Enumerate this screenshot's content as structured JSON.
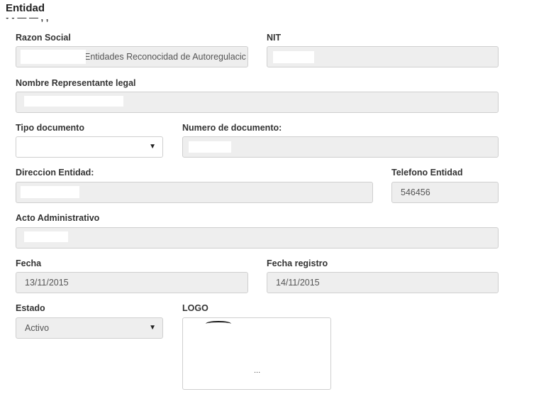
{
  "page": {
    "title": "Entidad"
  },
  "form": {
    "razon_social": {
      "label": "Razon Social",
      "value": "Entidades Reconocidad de Autoregulacic"
    },
    "nit": {
      "label": "NIT",
      "value": ""
    },
    "representante": {
      "label": "Nombre Representante legal",
      "value": ""
    },
    "tipo_documento": {
      "label": "Tipo documento",
      "value": "",
      "caret": "▼"
    },
    "numero_documento": {
      "label": "Numero de documento:",
      "value": ""
    },
    "direccion": {
      "label": "Direccion Entidad:",
      "value": ""
    },
    "telefono": {
      "label": "Telefono Entidad",
      "value": "546456"
    },
    "acto": {
      "label": "Acto Administrativo",
      "value": ""
    },
    "fecha": {
      "label": "Fecha",
      "value": "13/11/2015"
    },
    "fecha_registro": {
      "label": "Fecha registro",
      "value": "14/11/2015"
    },
    "estado": {
      "label": "Estado",
      "value": "Activo",
      "caret": "▼"
    },
    "logo": {
      "label": "LOGO",
      "placeholder": "..."
    }
  }
}
